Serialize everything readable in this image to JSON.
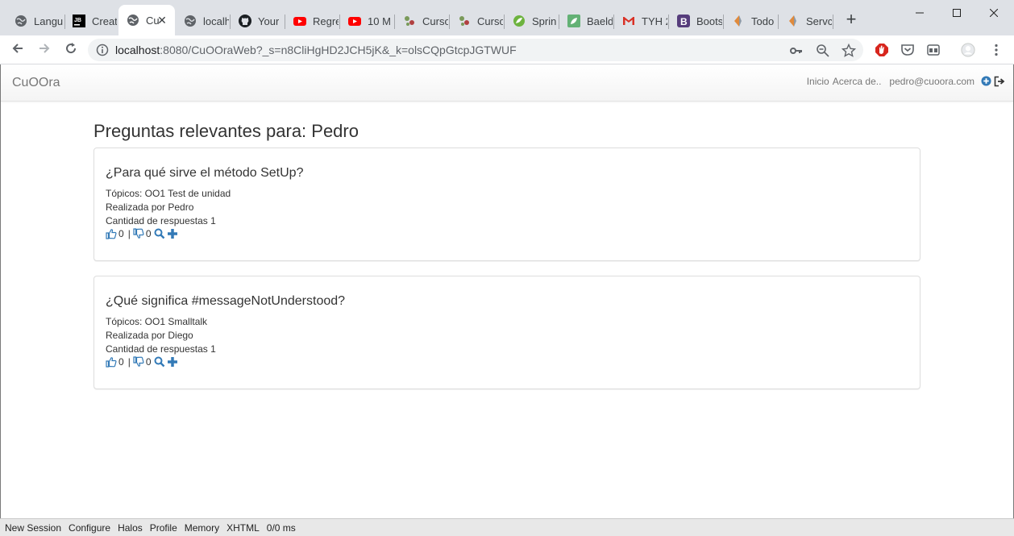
{
  "browser": {
    "tabs": [
      {
        "title": "Langu",
        "icon": "globe-icon"
      },
      {
        "title": "Creat",
        "icon": "jetbrains-icon"
      },
      {
        "title": "Cu",
        "icon": "globe-icon",
        "active": true
      },
      {
        "title": "localh",
        "icon": "globe-icon"
      },
      {
        "title": "Your",
        "icon": "github-icon"
      },
      {
        "title": "Regre",
        "icon": "youtube-icon"
      },
      {
        "title": "10 M",
        "icon": "youtube-icon"
      },
      {
        "title": "Curso",
        "icon": "course-icon"
      },
      {
        "title": "Curso",
        "icon": "course-icon"
      },
      {
        "title": "Sprin",
        "icon": "spring-icon"
      },
      {
        "title": "Baeld",
        "icon": "baeldung-icon"
      },
      {
        "title": "TYH 2",
        "icon": "gmail-icon"
      },
      {
        "title": "Boots",
        "icon": "bootstrap-icon"
      },
      {
        "title": "Todo",
        "icon": "bookmark-icon"
      },
      {
        "title": "Servc",
        "icon": "bookmark-icon"
      }
    ],
    "url_host": "localhost",
    "url_rest": ":8080/CuOOraWeb?_s=n8CliHgHD2JCH5jK&_k=olsCQpGtcpJGTWUF",
    "colors": {
      "tabstrip": "#dee1e6",
      "omnibox": "#f1f3f4"
    }
  },
  "navbar": {
    "brand": "CuOOra",
    "links": [
      "Inicio",
      "Acerca de.."
    ],
    "user": "pedro@cuoora.com",
    "icons": [
      "plus-circle-icon",
      "logout-icon"
    ]
  },
  "page": {
    "title": "Preguntas relevantes para: Pedro"
  },
  "questions": [
    {
      "title": "¿Para qué sirve el método SetUp?",
      "topics": "Tópicos: OO1 Test de unidad",
      "author": "Realizada por Pedro",
      "answers": "Cantidad de respuestas 1",
      "likes": "0",
      "separator": "|",
      "dislikes": "0"
    },
    {
      "title": "¿Qué significa #messageNotUnderstood?",
      "topics": "Tópicos: OO1 Smalltalk",
      "author": "Realizada por Diego",
      "answers": "Cantidad de respuestas 1",
      "likes": "0",
      "separator": "|",
      "dislikes": "0"
    }
  ],
  "devbar": {
    "items": [
      "New Session",
      "Configure",
      "Halos",
      "Profile",
      "Memory",
      "XHTML",
      "0/0 ms"
    ]
  },
  "colors": {
    "link_blue": "#337ab7",
    "text": "#333333",
    "muted": "#777777"
  }
}
